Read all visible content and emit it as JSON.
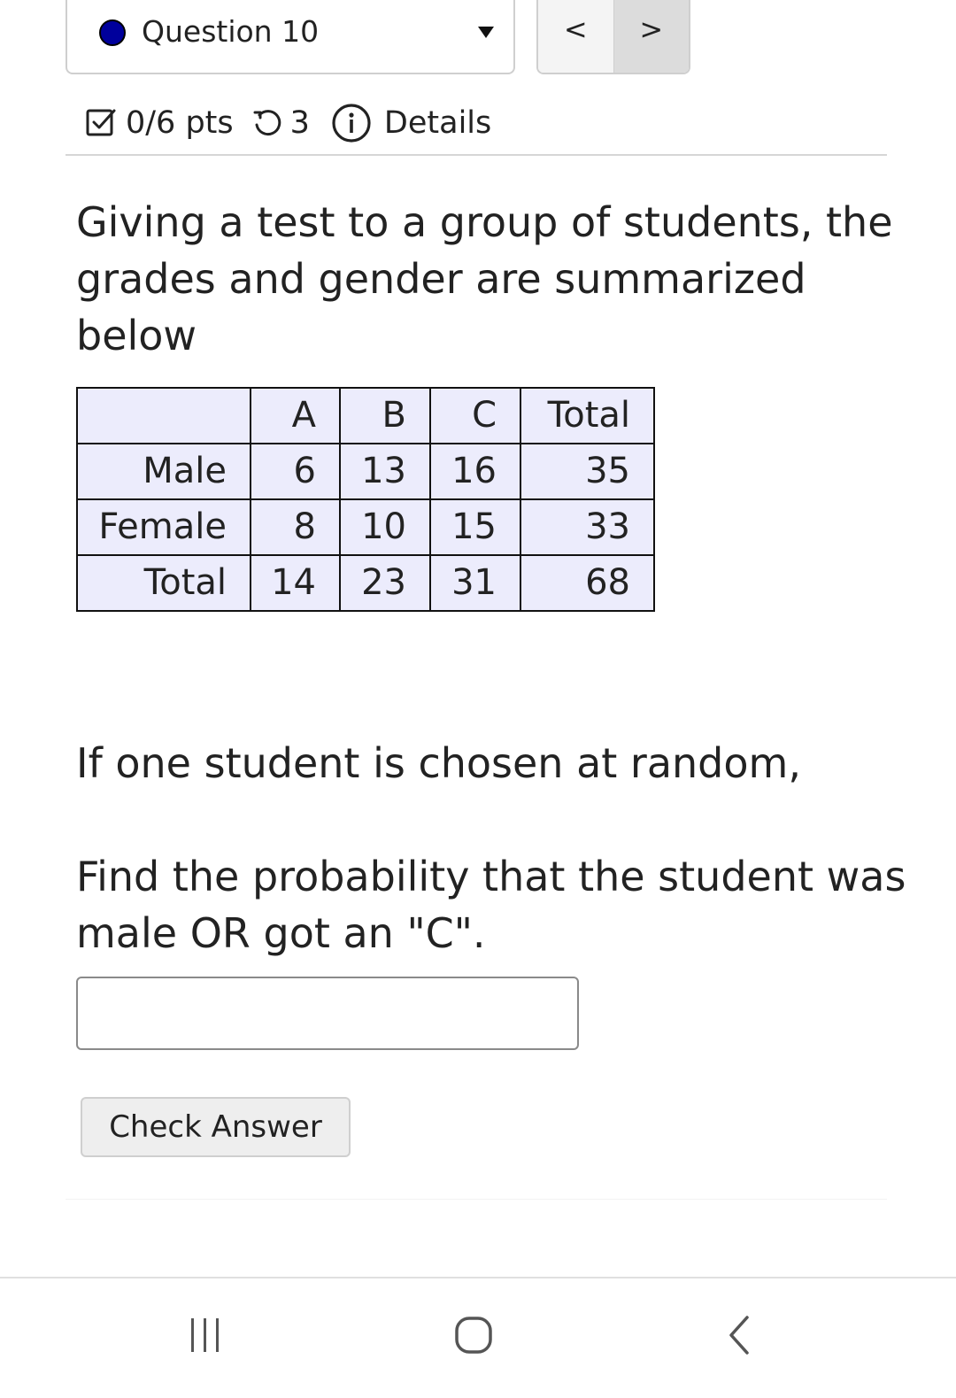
{
  "question_selector": {
    "label": "Question 10",
    "status_color": "#00009c",
    "prev_label": "<",
    "next_label": ">"
  },
  "score": {
    "points": "0/6 pts",
    "attempts": "3",
    "details_label": "Details"
  },
  "question": {
    "intro": "Giving a test to a group of students, the grades and gender are summarized below",
    "prompt_line1": "If one student is chosen at random,",
    "prompt_line2": "Find the probability that the student was male OR got an \"C\"."
  },
  "table": {
    "headers": [
      "",
      "A",
      "B",
      "C",
      "Total"
    ],
    "rows": [
      [
        "Male",
        "6",
        "13",
        "16",
        "35"
      ],
      [
        "Female",
        "8",
        "10",
        "15",
        "33"
      ],
      [
        "Total",
        "14",
        "23",
        "31",
        "68"
      ]
    ]
  },
  "answer": {
    "value": "",
    "placeholder": ""
  },
  "check_button": {
    "label": "Check Answer"
  },
  "system_nav": {
    "recents_icon": "recents-icon",
    "home_icon": "home-icon",
    "back_icon": "back-icon"
  }
}
